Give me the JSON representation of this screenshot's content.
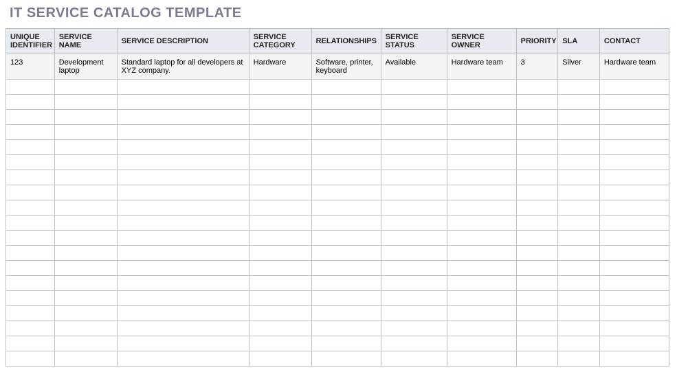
{
  "title": "IT SERVICE CATALOG TEMPLATE",
  "table": {
    "headers": [
      "UNIQUE IDENTIFIER",
      "SERVICE NAME",
      "SERVICE DESCRIPTION",
      "SERVICE CATEGORY",
      "RELATIONSHIPS",
      "SERVICE STATUS",
      "SERVICE OWNER",
      "PRIORITY",
      "SLA",
      "CONTACT"
    ],
    "rows": [
      {
        "unique_identifier": "123",
        "service_name": "Development laptop",
        "service_description": "Standard laptop for all developers at XYZ company.",
        "service_category": "Hardware",
        "relationships": "Software, printer, keyboard",
        "service_status": "Available",
        "service_owner": "Hardware team",
        "priority": "3",
        "sla": "Silver",
        "contact": "Hardware team"
      }
    ],
    "empty_row_count": 19
  }
}
